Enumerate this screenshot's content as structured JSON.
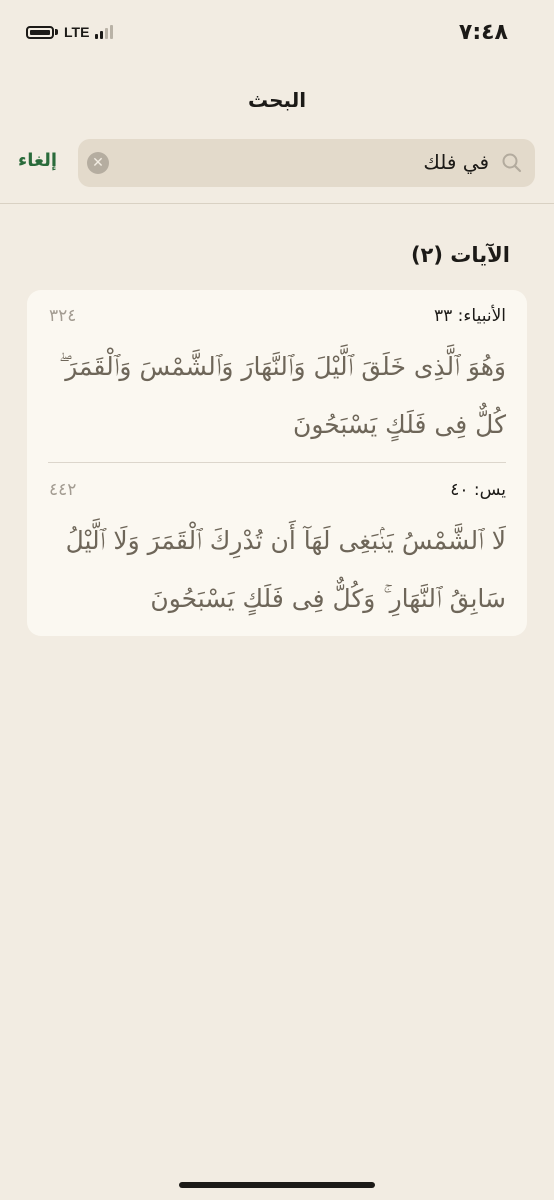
{
  "status_bar": {
    "time": "٧:٤٨",
    "network": "LTE"
  },
  "nav": {
    "title": "البحث"
  },
  "search": {
    "value": "في فلك",
    "cancel_label": "إلغاء"
  },
  "results": {
    "header": "الآيات (٢)",
    "items": [
      {
        "ref": "الأنبياء: ٣٣",
        "page": "٣٢٤",
        "text": "وَهُوَ ٱلَّذِى خَلَقَ ٱلَّيْلَ وَٱلنَّهَارَ وَٱلشَّمْسَ وَٱلْقَمَرَ ۖ كُلٌّ فِى فَلَكٍ يَسْبَحُونَ"
      },
      {
        "ref": "يس: ٤٠",
        "page": "٤٤٢",
        "text": "لَا ٱلشَّمْسُ يَنۢبَغِى لَهَآ أَن تُدْرِكَ ٱلْقَمَرَ وَلَا ٱلَّيْلُ سَابِقُ ٱلنَّهَارِ ۚ وَكُلٌّ فِى فَلَكٍ يَسْبَحُونَ"
      }
    ]
  },
  "colors": {
    "background": "#f2ece2",
    "card": "#fbf8f1",
    "accent": "#2a6b3b",
    "verse_text": "#6e6659"
  },
  "icons": {
    "search": "search-icon",
    "clear": "clear-icon",
    "battery": "battery-icon",
    "signal": "signal-icon"
  }
}
